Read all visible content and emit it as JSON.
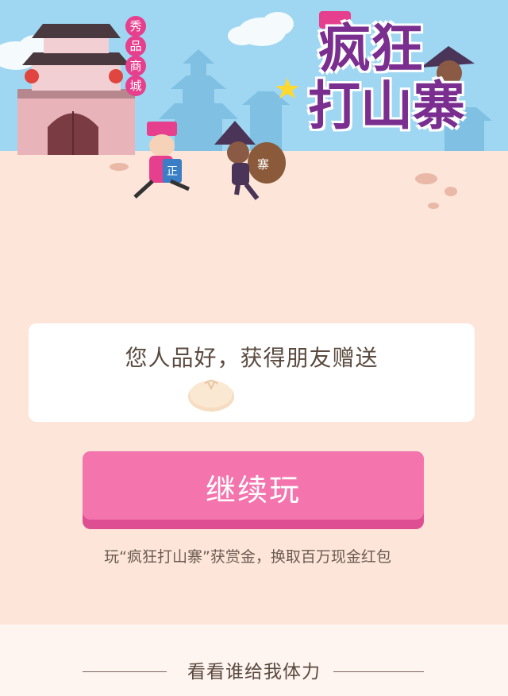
{
  "hero": {
    "shop_badge": [
      "秀",
      "品",
      "商",
      "城"
    ],
    "game_title_line1": "疯狂",
    "game_title_line2": "打山寨",
    "sack_label": "寨",
    "badge_label": "正"
  },
  "card": {
    "message": "您人品好，获得朋友赠送",
    "icon": "steamed-bun-icon"
  },
  "continue_button": {
    "label": "继续玩"
  },
  "tip": "玩“疯狂打山寨”获赏金，换取百万现金红包",
  "bottom": {
    "title": "看看谁给我体力"
  },
  "colors": {
    "sky": "#9fd7f2",
    "background": "#fde6d9",
    "button": "#f474ad",
    "title_purple": "#7a2e8f"
  }
}
